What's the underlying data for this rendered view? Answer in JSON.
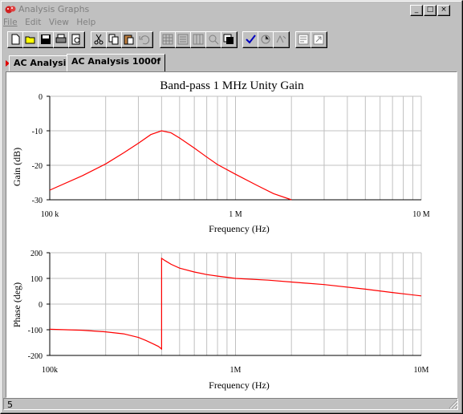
{
  "window": {
    "title": "Analysis Graphs",
    "controls": [
      "_",
      "□",
      "×"
    ]
  },
  "menu": [
    {
      "label": "File"
    },
    {
      "label": "Edit"
    },
    {
      "label": "View"
    },
    {
      "label": "Help"
    }
  ],
  "toolbar": {
    "buttons": [
      "new-icon",
      "open-icon",
      "save-icon",
      "print-icon",
      "print-preview-icon",
      "cut-icon",
      "copy-icon",
      "paste-icon",
      "undo-icon",
      "grid-icon",
      "legend-icon",
      "cursor-icon",
      "zoom-icon",
      "pan-icon",
      "select-icon",
      "toggle-icon",
      "restore-icon",
      "properties-icon",
      "export-icon"
    ]
  },
  "tabs": [
    {
      "label": "AC Analysis"
    },
    {
      "label": "AC Analysis 1000f"
    }
  ],
  "status": {
    "text": "5"
  },
  "colors": {
    "trace": "#ff0000",
    "grid": "#c0c0c0"
  },
  "chart_data": [
    {
      "type": "line",
      "title": "Band-pass 1 MHz Unity Gain",
      "xlabel": "Frequency (Hz)",
      "ylabel": "Gain (dB)",
      "xscale": "log",
      "xlim": [
        100000,
        10000000
      ],
      "ylim": [
        -30,
        0
      ],
      "xticks": [
        "100 k",
        "1 M",
        "10 M"
      ],
      "yticks": [
        "0",
        "-10",
        "-20",
        "-30"
      ],
      "grid": true,
      "series": [
        {
          "x": [
            100000,
            150000,
            200000,
            250000,
            300000,
            350000,
            400000,
            450000,
            500000,
            600000,
            700000,
            800000,
            1000000,
            1300000,
            1600000,
            2000000
          ],
          "y": [
            -27.2,
            -23.0,
            -19.6,
            -16.4,
            -13.6,
            -11.1,
            -10.0,
            -10.6,
            -12.1,
            -15.0,
            -17.6,
            -19.8,
            -22.6,
            -25.8,
            -28.2,
            -30.0
          ]
        }
      ]
    },
    {
      "type": "line",
      "xlabel": "Frequency (Hz)",
      "ylabel": "Phase (deg)",
      "xscale": "log",
      "xlim": [
        100000,
        10000000
      ],
      "ylim": [
        -200,
        200
      ],
      "xticks": [
        "100k",
        "1M",
        "10M"
      ],
      "yticks": [
        "200",
        "100",
        "0",
        "-100",
        "-200"
      ],
      "grid": true,
      "series": [
        {
          "x": [
            100000,
            150000,
            200000,
            250000,
            300000,
            330000,
            360000,
            385000,
            400000,
            400100,
            420000,
            450000,
            500000,
            600000,
            700000,
            800000,
            1000000,
            1500000,
            2000000,
            3000000,
            5000000,
            7000000,
            10000000
          ],
          "y": [
            -98,
            -102,
            -108,
            -116,
            -130,
            -142,
            -155,
            -165,
            -175,
            178,
            168,
            155,
            140,
            125,
            115,
            109,
            100,
            93,
            86,
            76,
            58,
            45,
            32
          ]
        }
      ]
    }
  ]
}
